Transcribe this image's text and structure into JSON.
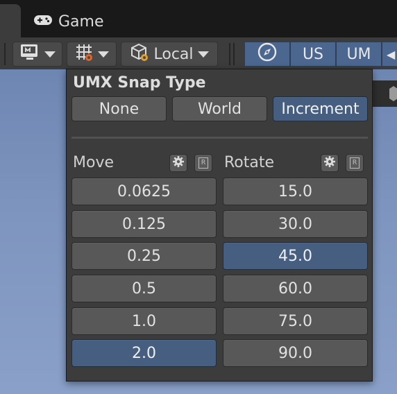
{
  "tabs": {
    "game_label": "Game"
  },
  "toolbar": {
    "local_label": "Local",
    "us_label": "US",
    "um_label": "UM"
  },
  "snap_panel": {
    "title": "UMX Snap Type",
    "types": [
      "None",
      "World",
      "Increment"
    ],
    "selected_type": "Increment",
    "move": {
      "label": "Move",
      "values": [
        "0.0625",
        "0.125",
        "0.25",
        "0.5",
        "1.0",
        "2.0"
      ],
      "selected": "2.0"
    },
    "rotate": {
      "label": "Rotate",
      "values": [
        "15.0",
        "30.0",
        "45.0",
        "60.0",
        "75.0",
        "90.0"
      ],
      "selected": "45.0"
    },
    "reset_glyph": "R"
  },
  "colors": {
    "selected": "#465e80",
    "button": "#585858",
    "panel": "#3c3c3c",
    "scene_sky": "#7e95bf"
  }
}
